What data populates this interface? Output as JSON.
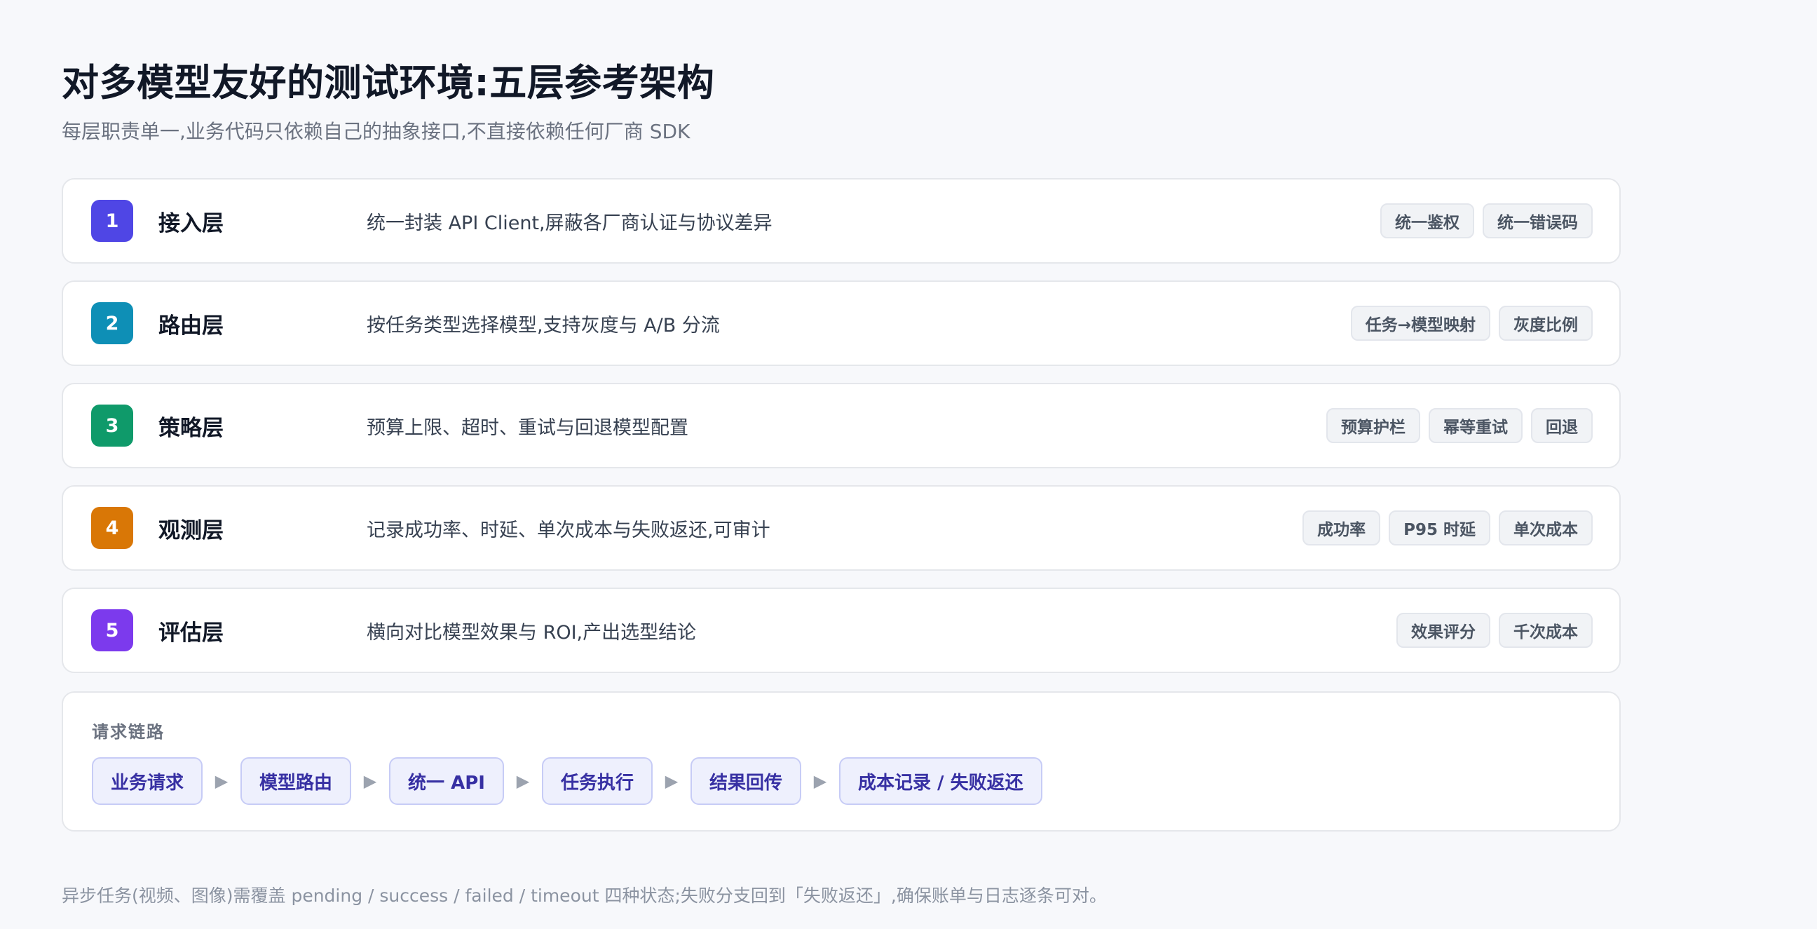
{
  "header": {
    "title": "对多模型友好的测试环境:五层参考架构",
    "subtitle": "每层职责单一,业务代码只依赖自己的抽象接口,不直接依赖任何厂商 SDK"
  },
  "layers": [
    {
      "number": "1",
      "name": "接入层",
      "description": "统一封装 API Client,屏蔽各厂商认证与协议差异",
      "color": "#4f46e5",
      "tags": [
        "统一鉴权",
        "统一错误码"
      ]
    },
    {
      "number": "2",
      "name": "路由层",
      "description": "按任务类型选择模型,支持灰度与 A/B 分流",
      "color": "#0e8fb6",
      "tags": [
        "任务→模型映射",
        "灰度比例"
      ]
    },
    {
      "number": "3",
      "name": "策略层",
      "description": "预算上限、超时、重试与回退模型配置",
      "color": "#0f9a6a",
      "tags": [
        "预算护栏",
        "幂等重试",
        "回退"
      ]
    },
    {
      "number": "4",
      "name": "观测层",
      "description": "记录成功率、时延、单次成本与失败返还,可审计",
      "color": "#d97706",
      "tags": [
        "成功率",
        "P95 时延",
        "单次成本"
      ]
    },
    {
      "number": "5",
      "name": "评估层",
      "description": "横向对比模型效果与 ROI,产出选型结论",
      "color": "#7c3aed",
      "tags": [
        "效果评分",
        "千次成本"
      ]
    }
  ],
  "flow": {
    "label": "请求链路",
    "steps": [
      "业务请求",
      "模型路由",
      "统一 API",
      "任务执行",
      "结果回传",
      "成本记录 / 失败返还"
    ],
    "arrow_icon": "triangle-right-icon"
  },
  "footnote": "异步任务(视频、图像)需覆盖 pending / success / failed / timeout 四种状态;失败分支回到「失败返还」,确保账单与日志逐条可对。"
}
